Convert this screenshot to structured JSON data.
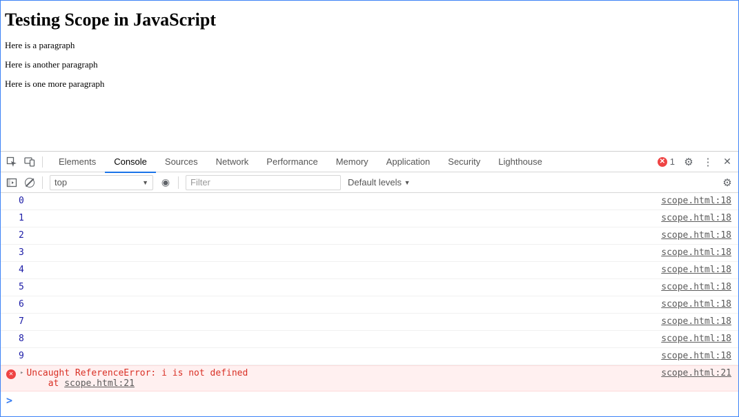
{
  "page": {
    "heading": "Testing Scope in JavaScript",
    "paragraphs": [
      "Here is a paragraph",
      "Here is another paragraph",
      "Here is one more paragraph"
    ]
  },
  "devtools": {
    "tabs": [
      "Elements",
      "Console",
      "Sources",
      "Network",
      "Performance",
      "Memory",
      "Application",
      "Security",
      "Lighthouse"
    ],
    "active_tab": "Console",
    "error_count": "1",
    "toolbar": {
      "context": "top",
      "filter_placeholder": "Filter",
      "levels": "Default levels"
    },
    "logs": [
      {
        "value": "0",
        "source": "scope.html:18"
      },
      {
        "value": "1",
        "source": "scope.html:18"
      },
      {
        "value": "2",
        "source": "scope.html:18"
      },
      {
        "value": "3",
        "source": "scope.html:18"
      },
      {
        "value": "4",
        "source": "scope.html:18"
      },
      {
        "value": "5",
        "source": "scope.html:18"
      },
      {
        "value": "6",
        "source": "scope.html:18"
      },
      {
        "value": "7",
        "source": "scope.html:18"
      },
      {
        "value": "8",
        "source": "scope.html:18"
      },
      {
        "value": "9",
        "source": "scope.html:18"
      }
    ],
    "error": {
      "message": "Uncaught ReferenceError: i is not defined",
      "at_prefix": "    at ",
      "location": "scope.html:21",
      "source": "scope.html:21"
    },
    "prompt": ">"
  }
}
